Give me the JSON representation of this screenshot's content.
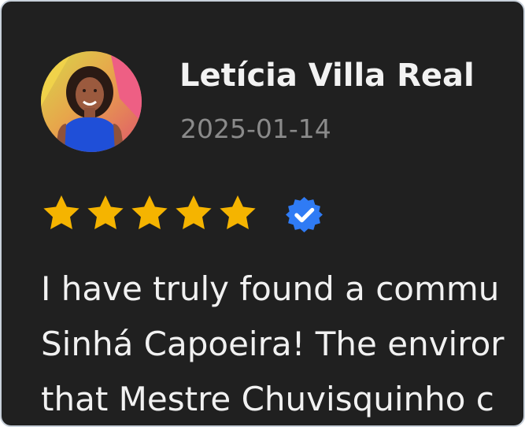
{
  "reviewer": {
    "name": "Letícia Villa Real",
    "date": "2025-01-14",
    "avatar_icon": "profile-photo"
  },
  "rating": {
    "stars": 5,
    "out_of": 5,
    "star_color": "#F5B400",
    "verified_icon": "verified-badge-icon",
    "verified_color": "#2F7BF5"
  },
  "review": {
    "lines": [
      "I have truly found a commu",
      "Sinhá Capoeira! The enviror",
      "that Mestre Chuvisquinho c"
    ]
  },
  "theme": {
    "card_background": "#202020",
    "name_color": "#F2F2F2",
    "date_color": "#8A8A8A"
  }
}
